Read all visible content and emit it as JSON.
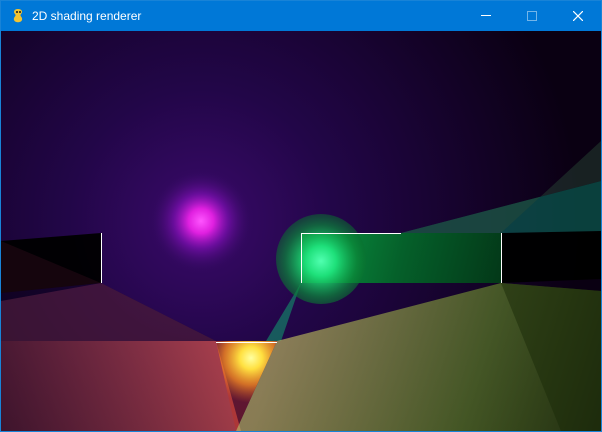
{
  "window": {
    "title": "2D shading renderer",
    "app_icon": "pygame-snake-icon",
    "titlebar_color": "#0078d7",
    "buttons": {
      "minimize_icon": "minimize-icon",
      "maximize_icon": "maximize-icon",
      "close_icon": "close-icon"
    }
  },
  "scene": {
    "background_color": "#100018",
    "lights": [
      {
        "name": "magenta-light",
        "color": "#ff33ff"
      },
      {
        "name": "green-light",
        "color": "#33ff99"
      },
      {
        "name": "yellow-light",
        "color": "#ffee55"
      }
    ],
    "walls_color": "#ffffff"
  }
}
